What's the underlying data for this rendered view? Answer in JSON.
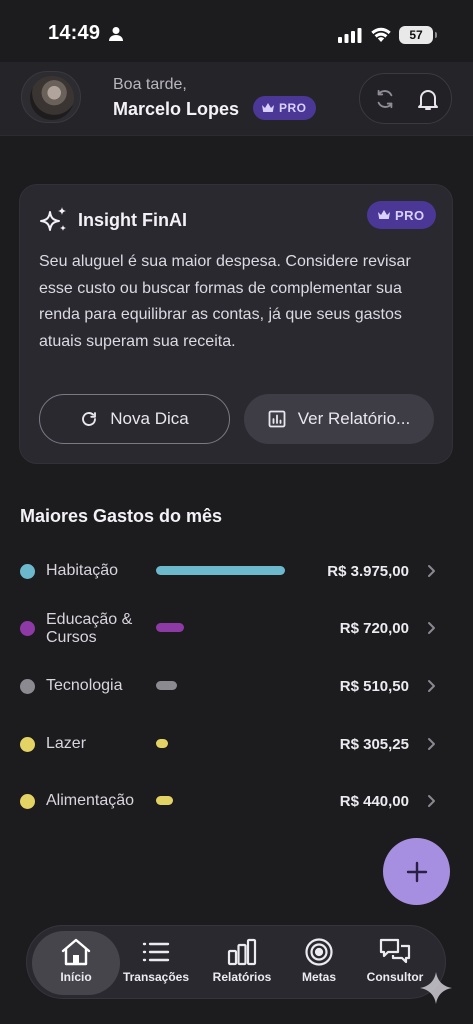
{
  "status_bar": {
    "time": "14:49",
    "battery": "57"
  },
  "header": {
    "greeting": "Boa tarde,",
    "user_name": "Marcelo Lopes",
    "badge": "PRO"
  },
  "insight": {
    "title": "Insight FinAI",
    "badge": "PRO",
    "text": "Seu aluguel é sua maior despesa. Considere revisar esse custo ou buscar formas de complementar sua renda para equilibrar as contas, já que seus gastos atuais superam sua receita.",
    "button_new": "Nova Dica",
    "button_report": "Ver Relatório..."
  },
  "expenses": {
    "title": "Maiores Gastos do mês",
    "items": [
      {
        "label": "Habitação",
        "amount": "R$ 3.975,00",
        "color": "#6cb8cc",
        "bar_fraction": 1.0
      },
      {
        "label": "Educação & Cursos",
        "amount": "R$ 720,00",
        "color": "#8e3aa6",
        "bar_fraction": 0.22
      },
      {
        "label": "Tecnologia",
        "amount": "R$ 510,50",
        "color": "#8b8a90",
        "bar_fraction": 0.16
      },
      {
        "label": "Lazer",
        "amount": "R$ 305,25",
        "color": "#e3d264",
        "bar_fraction": 0.09
      },
      {
        "label": "Alimentação",
        "amount": "R$ 440,00",
        "color": "#e3d264",
        "bar_fraction": 0.13
      }
    ]
  },
  "nav": {
    "items": [
      {
        "label": "Início",
        "icon": "home-icon",
        "active": true
      },
      {
        "label": "Transações",
        "icon": "list-icon",
        "active": false
      },
      {
        "label": "Relatórios",
        "icon": "bar-chart-icon",
        "active": false
      },
      {
        "label": "Metas",
        "icon": "target-icon",
        "active": false
      },
      {
        "label": "Consultor",
        "icon": "chat-icon",
        "active": false
      }
    ]
  },
  "colors": {
    "background": "#1c1b1e",
    "accent": "#a68fe0",
    "badge": "#4b3796"
  }
}
